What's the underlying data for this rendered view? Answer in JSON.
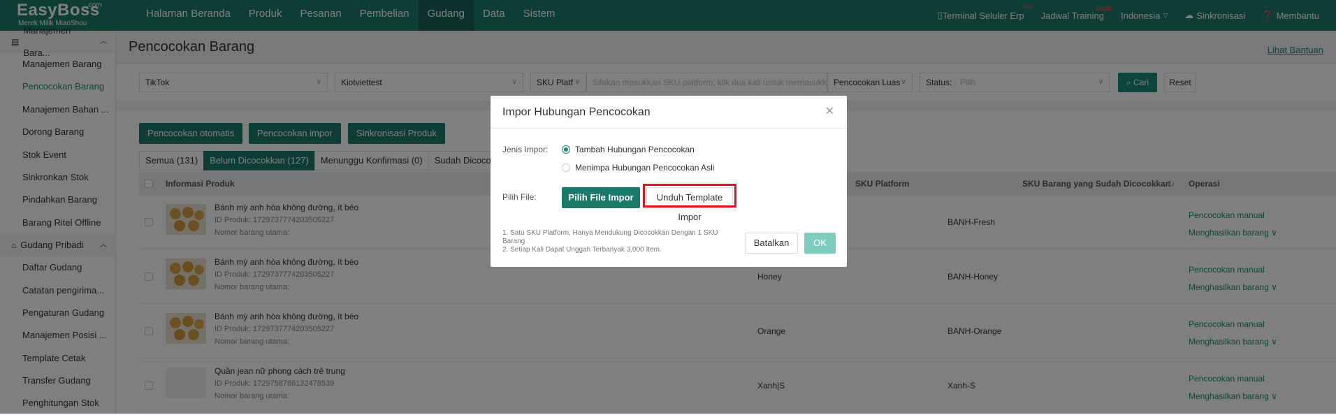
{
  "app": {
    "logo": "EasyBoss",
    "logo_com": ".com",
    "logo_sub": "Merek Milik MiaoShou"
  },
  "nav": [
    "Halaman Beranda",
    "Produk",
    "Pesanan",
    "Pembelian",
    "Gudang",
    "Data",
    "Sistem"
  ],
  "topright": {
    "terminal": "Terminal Seluler Erp",
    "terminal_badge": "ᴺᴱᵂ",
    "training": "Jadwal Training",
    "training_badge": "Gratis",
    "language": "Indonesia",
    "sync": "Sinkronisasi",
    "help": "Membantu"
  },
  "sidebar": {
    "group1": "Manajemen Bara...",
    "items1": [
      "Manajemen Barang",
      "Pencocokan Barang",
      "Manajemen Bahan ...",
      "Dorong Barang",
      "Stok Event",
      "Sinkronkan Stok",
      "Pindahkan Barang",
      "Barang Ritel Offline"
    ],
    "group2": "Gudang Pribadi",
    "items2": [
      "Daftar Gudang",
      "Catatan pengirima...",
      "Pengaturan Gudang",
      "Manajemen Posisi ...",
      "Template Cetak",
      "Transfer Gudang",
      "Penghitungan Stok"
    ]
  },
  "page": {
    "title": "Pencocokan Barang",
    "help_link": "Lihat Bantuan"
  },
  "filters": {
    "platform": "TikTok",
    "store": "Kiotviettest",
    "sku_type": "SKU Platf",
    "sku_placeholder": "Silakan masukkan SKU platform, klik dua kali untuk memasukkan",
    "match_type": "Pencocokan Luas",
    "status_label": "Status:",
    "status_placeholder": "Pilih",
    "search": "Cari",
    "reset": "Reset"
  },
  "actions": [
    "Pencocokan otomatis",
    "Pencocokan impor",
    "Sinkronisasi Produk"
  ],
  "tabs": [
    "Semua (131)",
    "Belum Dicocokkan (127)",
    "Menunggu Konfirmasi (0)",
    "Sudah Dicocokk"
  ],
  "table": {
    "headers": {
      "info": "Informasi Produk",
      "sku_platform": "SKU Platform",
      "sku_matched": "SKU Barang yang Sudah Dicocokkan",
      "ops": "Operasi"
    },
    "rows": [
      {
        "name": "Bánh mỳ anh hòa không đường, ít béo",
        "id": "ID Produk: 1729737774203505227",
        "num": "Nomor barang utama:",
        "variant": "",
        "sku": "BANH-Fresh",
        "op1": "Pencocokan manual",
        "op2": "Menghasilkan barang",
        "img": true
      },
      {
        "name": "Bánh mỳ anh hòa không đường, ít béo",
        "id": "ID Produk: 1729737774203505227",
        "num": "Nomor barang utama:",
        "variant": "Honey",
        "sku": "BANH-Honey",
        "op1": "Pencocokan manual",
        "op2": "Menghasilkan barang",
        "img": true
      },
      {
        "name": "Bánh mỳ anh hòa không đường, ít béo",
        "id": "ID Produk: 1729737774203505227",
        "num": "Nomor barang utama:",
        "variant": "Orange",
        "sku": "BANH-Orange",
        "op1": "Pencocokan manual",
        "op2": "Menghasilkan barang",
        "img": true
      },
      {
        "name": "Quần jean nữ phong cách trẻ trung",
        "id": "ID Produk: 1729758786132478539",
        "num": "Nomor barang utama:",
        "variant": "Xanh|S",
        "sku": "Xanh-S",
        "op1": "Pencocokan manual",
        "op2": "Menghasilkan barang",
        "img": false
      }
    ]
  },
  "modal": {
    "title": "Impor Hubungan Pencocokan",
    "type_label": "Jenis Impor:",
    "option1": "Tambah Hubungan Pencocokan",
    "option2": "Menimpa Hubungan Pencocokan Asli",
    "file_label": "Pilih File:",
    "choose_file": "Pilih File Impor",
    "download_template": "Unduh Template Impor",
    "note1": "1. Satu SKU Platform, Hanya Mendukung Dicocokkan Dengan 1 SKU Barang",
    "note2": "2. Setiap Kali Dapat Unggah Terbanyak 3,000 Item.",
    "cancel": "Batalkan",
    "ok": "OK"
  }
}
